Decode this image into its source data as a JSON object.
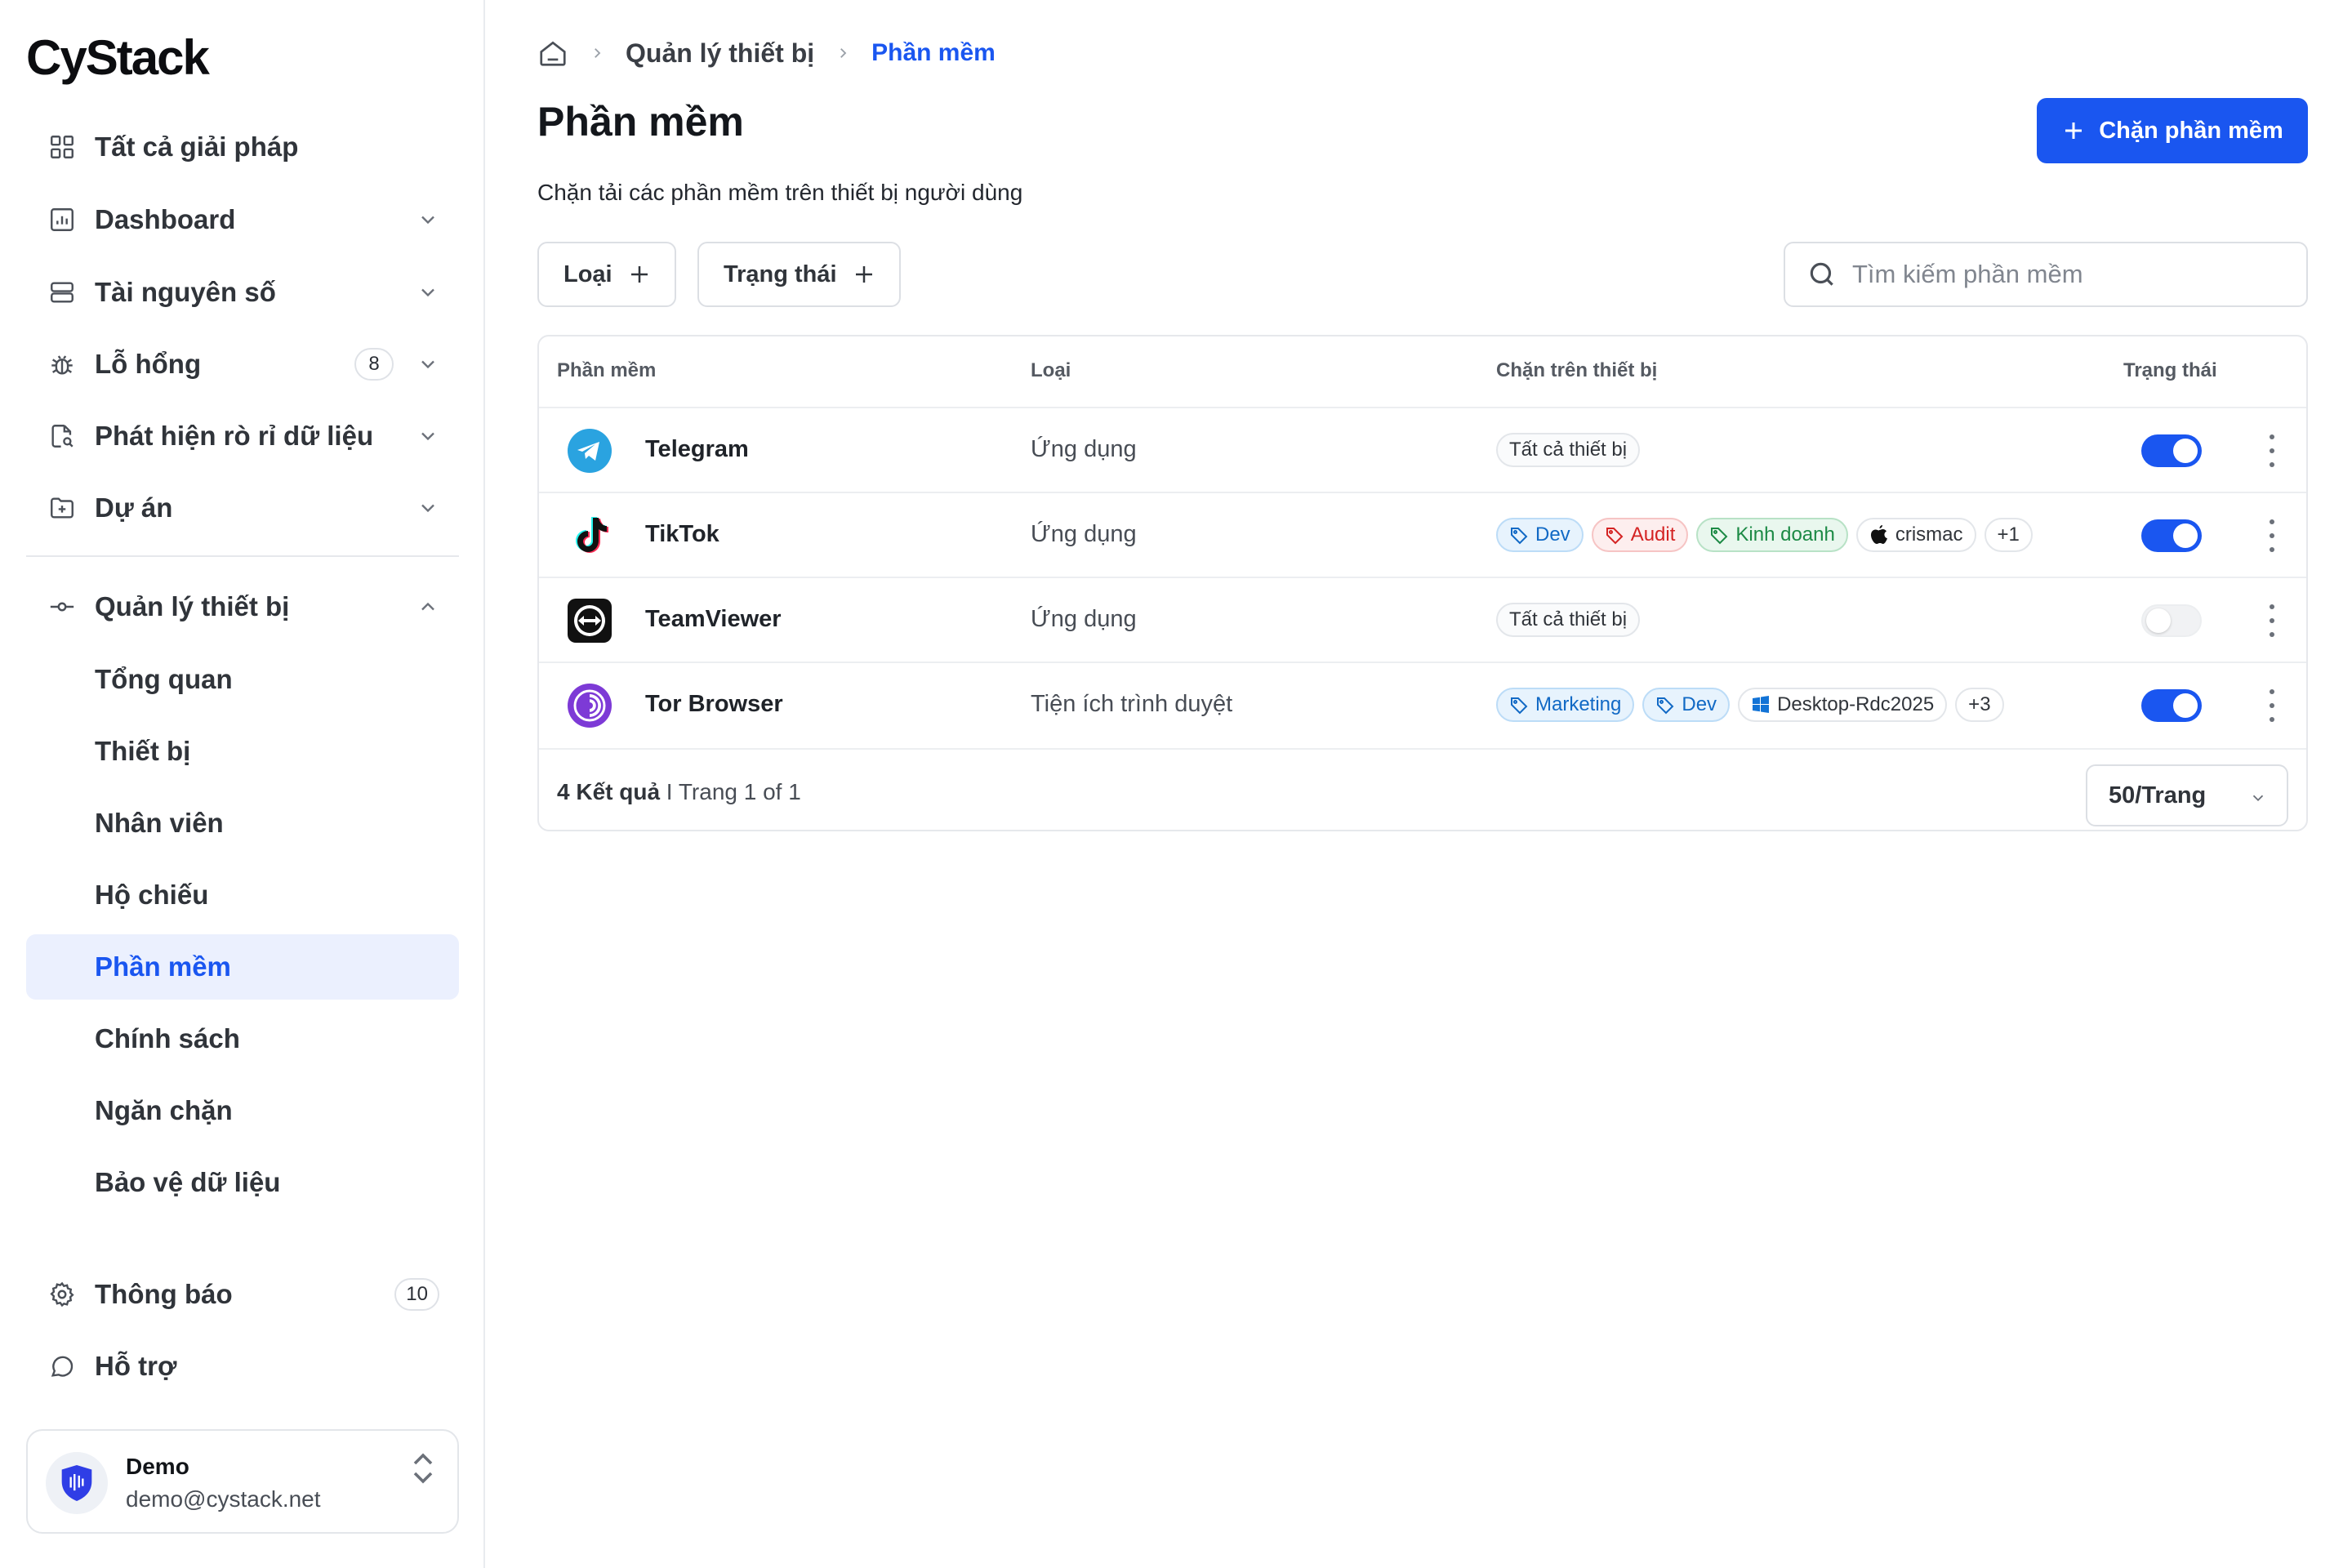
{
  "brand": "CyStack",
  "sidebar": {
    "items": [
      {
        "label": "Tất cả giải pháp"
      },
      {
        "label": "Dashboard"
      },
      {
        "label": "Tài nguyên số"
      },
      {
        "label": "Lỗ hổng",
        "badge": "8"
      },
      {
        "label": "Phát hiện rò rỉ dữ liệu"
      },
      {
        "label": "Dự án"
      },
      {
        "label": "Quản lý thiết bị"
      }
    ],
    "sub_items": [
      {
        "label": "Tổng quan"
      },
      {
        "label": "Thiết bị"
      },
      {
        "label": "Nhân viên"
      },
      {
        "label": "Hộ chiếu"
      },
      {
        "label": "Phần mềm",
        "active": true
      },
      {
        "label": "Chính sách"
      },
      {
        "label": "Ngăn chặn"
      },
      {
        "label": "Bảo vệ dữ liệu"
      }
    ],
    "bottom": [
      {
        "label": "Thông báo",
        "badge": "10"
      },
      {
        "label": "Hỗ trợ"
      }
    ],
    "user": {
      "name": "Demo",
      "email": "demo@cystack.net"
    }
  },
  "breadcrumb": {
    "parent": "Quản lý thiết bị",
    "current": "Phần mềm"
  },
  "header": {
    "title": "Phần mềm",
    "subtitle": "Chặn tải các phần mềm trên thiết bị người dùng",
    "primary_button": "Chặn phần mềm"
  },
  "filters": {
    "type": "Loại",
    "status": "Trạng thái"
  },
  "search": {
    "placeholder": "Tìm kiếm phần mềm",
    "value": ""
  },
  "table": {
    "columns": [
      "Phần mềm",
      "Loại",
      "Chặn trên thiết bị",
      "Trạng thái"
    ],
    "rows": [
      {
        "name": "Telegram",
        "type": "Ứng dụng",
        "tags": [
          "Tất cả thiết bị"
        ],
        "enabled": true
      },
      {
        "name": "TikTok",
        "type": "Ứng dụng",
        "tags": [
          "Dev",
          "Audit",
          "Kinh doanh",
          "crismac",
          "+1"
        ],
        "enabled": true
      },
      {
        "name": "TeamViewer",
        "type": "Ứng dụng",
        "tags": [
          "Tất cả thiết bị"
        ],
        "enabled": false
      },
      {
        "name": "Tor Browser",
        "type": "Tiện ích trình duyệt",
        "tags": [
          "Marketing",
          "Dev",
          "Desktop-Rdc2025",
          "+3"
        ],
        "enabled": true
      }
    ],
    "footer": {
      "count": "4 Kết quả",
      "pages": " I Trang 1 of 1",
      "page_size": "50/Trang"
    }
  },
  "colors": {
    "accent": "#1a56f0",
    "active_bg": "#ebf0fe"
  },
  "icons": [
    "grid-icon",
    "dashboard-icon",
    "server-icon",
    "bug-icon",
    "file-search-icon",
    "folder-plus-icon",
    "device-manage-icon",
    "gear-icon",
    "chat-icon",
    "home-icon",
    "plus-icon",
    "search-icon",
    "chevron-down-icon",
    "tag-icon",
    "apple-icon",
    "windows-icon",
    "kebab-icon",
    "shield-icon"
  ]
}
